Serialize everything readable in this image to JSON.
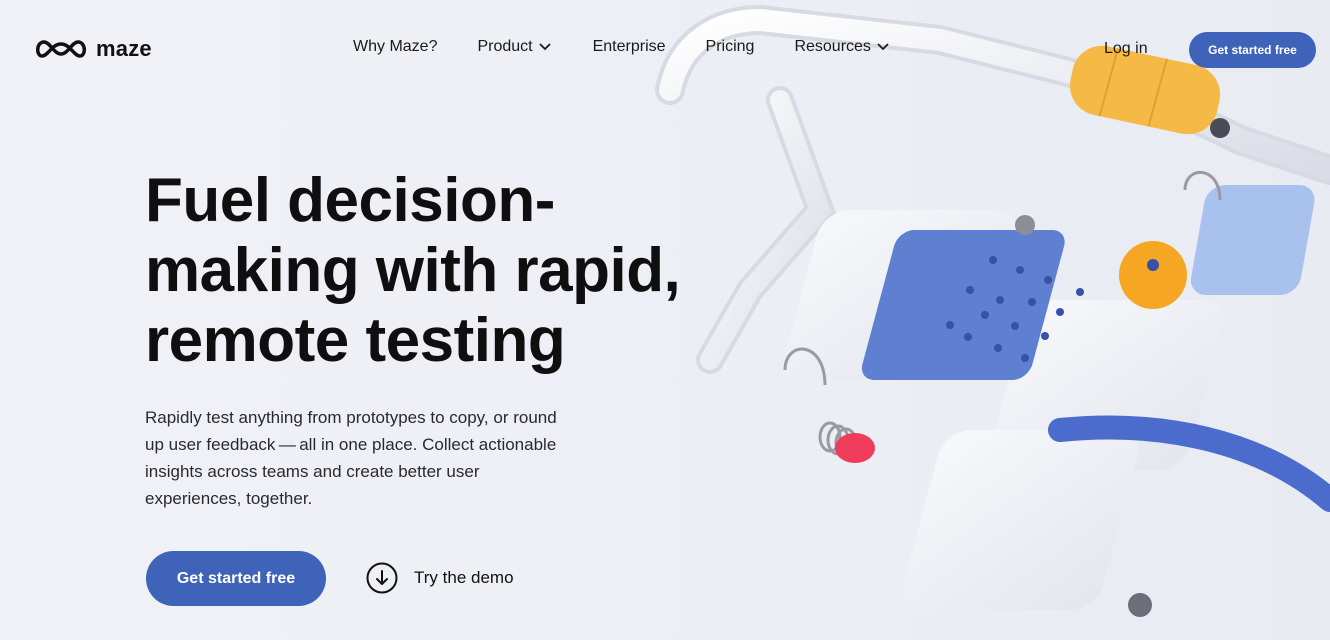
{
  "header": {
    "logo_text": "maze",
    "nav": [
      {
        "label": "Why Maze?",
        "has_dropdown": false
      },
      {
        "label": "Product",
        "has_dropdown": true
      },
      {
        "label": "Enterprise",
        "has_dropdown": false
      },
      {
        "label": "Pricing",
        "has_dropdown": false
      },
      {
        "label": "Resources",
        "has_dropdown": true
      }
    ],
    "login_label": "Log in",
    "cta_label": "Get started free"
  },
  "hero": {
    "title": "Fuel decision-making with rapid, remote testing",
    "subtitle": "Rapidly test anything from prototypes to copy, or round up user feedback — all in one place. Collect actionable insights across teams and create better user experiences, together.",
    "cta_label": "Get started free",
    "demo_label": "Try the demo"
  },
  "colors": {
    "accent": "#3f63b8",
    "background": "#eef0f6",
    "text": "#111111"
  },
  "icons": {
    "logo": "maze-logo-icon",
    "dropdown": "chevron-down-icon",
    "demo": "arrow-down-circle-icon"
  }
}
